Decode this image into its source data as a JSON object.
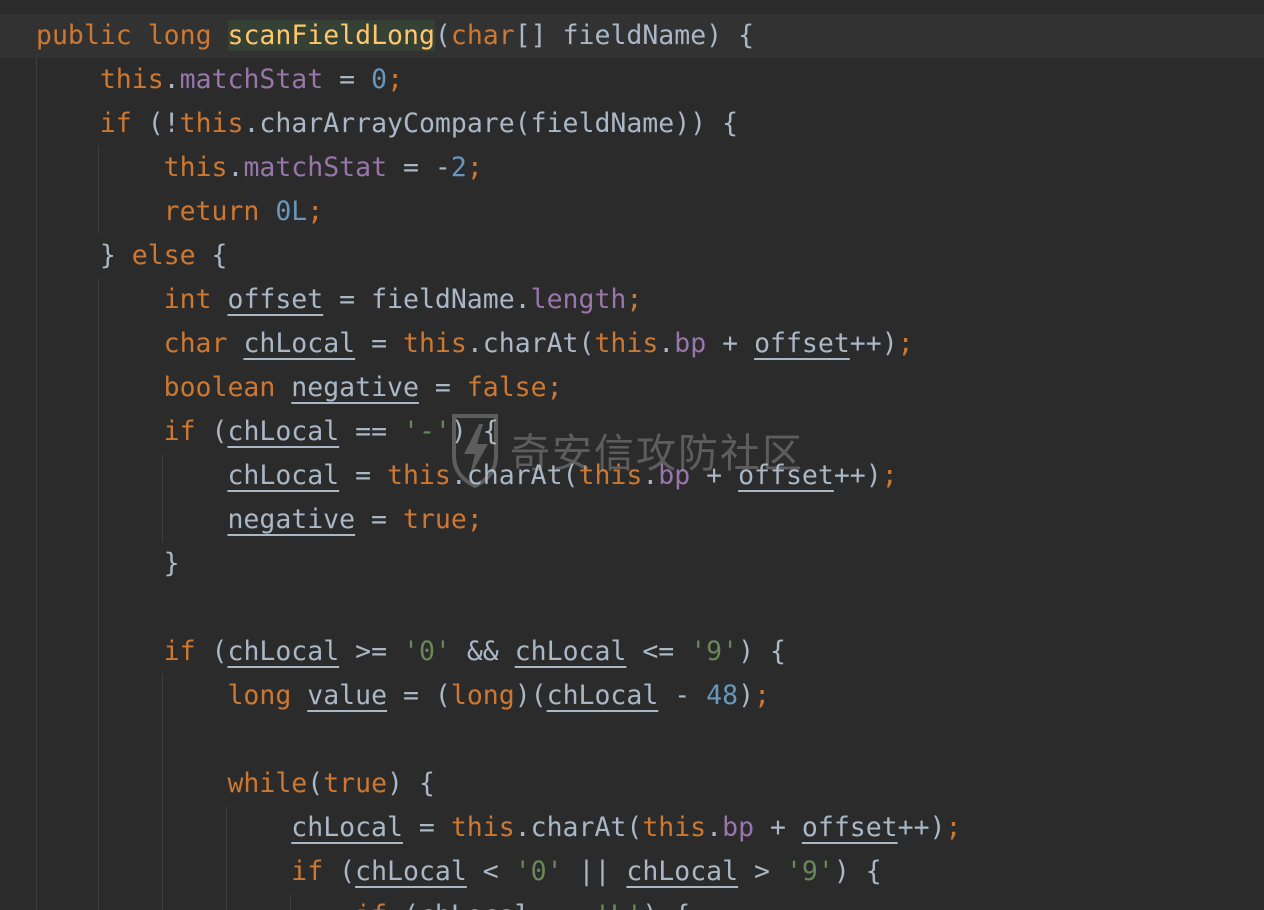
{
  "editor": {
    "watermark": "奇安信攻防社区",
    "lines": [
      {
        "tokens": [
          {
            "t": "public",
            "c": "kw"
          },
          {
            "t": " "
          },
          {
            "t": "long",
            "c": "kw"
          },
          {
            "t": " "
          },
          {
            "t": "scanFieldLong",
            "c": "fn hl"
          },
          {
            "t": "("
          },
          {
            "t": "char",
            "c": "kw"
          },
          {
            "t": "[] fieldName) {"
          }
        ]
      },
      {
        "tokens": [
          {
            "t": "    "
          },
          {
            "t": "this",
            "c": "kw"
          },
          {
            "t": "."
          },
          {
            "t": "matchStat",
            "c": "fld"
          },
          {
            "t": " = "
          },
          {
            "t": "0",
            "c": "num"
          },
          {
            "t": ";",
            "c": "kw"
          }
        ]
      },
      {
        "tokens": [
          {
            "t": "    "
          },
          {
            "t": "if",
            "c": "kw"
          },
          {
            "t": " (!"
          },
          {
            "t": "this",
            "c": "kw"
          },
          {
            "t": ".charArrayCompare(fieldName)) {"
          }
        ]
      },
      {
        "tokens": [
          {
            "t": "        "
          },
          {
            "t": "this",
            "c": "kw"
          },
          {
            "t": "."
          },
          {
            "t": "matchStat",
            "c": "fld"
          },
          {
            "t": " = -"
          },
          {
            "t": "2",
            "c": "num"
          },
          {
            "t": ";",
            "c": "kw"
          }
        ]
      },
      {
        "tokens": [
          {
            "t": "        "
          },
          {
            "t": "return",
            "c": "kw"
          },
          {
            "t": " "
          },
          {
            "t": "0L",
            "c": "num"
          },
          {
            "t": ";",
            "c": "kw"
          }
        ]
      },
      {
        "tokens": [
          {
            "t": "    } "
          },
          {
            "t": "else",
            "c": "kw"
          },
          {
            "t": " {"
          }
        ]
      },
      {
        "tokens": [
          {
            "t": "        "
          },
          {
            "t": "int",
            "c": "kw"
          },
          {
            "t": " "
          },
          {
            "t": "offset",
            "c": "var"
          },
          {
            "t": " = fieldName."
          },
          {
            "t": "length",
            "c": "fld"
          },
          {
            "t": ";",
            "c": "kw"
          }
        ]
      },
      {
        "tokens": [
          {
            "t": "        "
          },
          {
            "t": "char",
            "c": "kw"
          },
          {
            "t": " "
          },
          {
            "t": "chLocal",
            "c": "var"
          },
          {
            "t": " = "
          },
          {
            "t": "this",
            "c": "kw"
          },
          {
            "t": ".charAt("
          },
          {
            "t": "this",
            "c": "kw"
          },
          {
            "t": "."
          },
          {
            "t": "bp",
            "c": "fld"
          },
          {
            "t": " + "
          },
          {
            "t": "offset",
            "c": "var"
          },
          {
            "t": "++)"
          },
          {
            "t": ";",
            "c": "kw"
          }
        ]
      },
      {
        "tokens": [
          {
            "t": "        "
          },
          {
            "t": "boolean",
            "c": "kw"
          },
          {
            "t": " "
          },
          {
            "t": "negative",
            "c": "var"
          },
          {
            "t": " = "
          },
          {
            "t": "false",
            "c": "kw"
          },
          {
            "t": ";",
            "c": "kw"
          }
        ]
      },
      {
        "tokens": [
          {
            "t": "        "
          },
          {
            "t": "if",
            "c": "kw"
          },
          {
            "t": " ("
          },
          {
            "t": "chLocal",
            "c": "var"
          },
          {
            "t": " == "
          },
          {
            "t": "'-'",
            "c": "str"
          },
          {
            "t": ") {"
          }
        ]
      },
      {
        "tokens": [
          {
            "t": "            "
          },
          {
            "t": "chLocal",
            "c": "var"
          },
          {
            "t": " = "
          },
          {
            "t": "this",
            "c": "kw"
          },
          {
            "t": ".charAt("
          },
          {
            "t": "this",
            "c": "kw"
          },
          {
            "t": "."
          },
          {
            "t": "bp",
            "c": "fld"
          },
          {
            "t": " + "
          },
          {
            "t": "offset",
            "c": "var"
          },
          {
            "t": "++)"
          },
          {
            "t": ";",
            "c": "kw"
          }
        ]
      },
      {
        "tokens": [
          {
            "t": "            "
          },
          {
            "t": "negative",
            "c": "var"
          },
          {
            "t": " = "
          },
          {
            "t": "true",
            "c": "kw"
          },
          {
            "t": ";",
            "c": "kw"
          }
        ]
      },
      {
        "tokens": [
          {
            "t": "        }"
          }
        ]
      },
      {
        "tokens": [
          {
            "t": ""
          }
        ]
      },
      {
        "tokens": [
          {
            "t": "        "
          },
          {
            "t": "if",
            "c": "kw"
          },
          {
            "t": " ("
          },
          {
            "t": "chLocal",
            "c": "var"
          },
          {
            "t": " >= "
          },
          {
            "t": "'0'",
            "c": "str"
          },
          {
            "t": " && "
          },
          {
            "t": "chLocal",
            "c": "var"
          },
          {
            "t": " <= "
          },
          {
            "t": "'9'",
            "c": "str"
          },
          {
            "t": ") {"
          }
        ]
      },
      {
        "tokens": [
          {
            "t": "            "
          },
          {
            "t": "long",
            "c": "kw"
          },
          {
            "t": " "
          },
          {
            "t": "value",
            "c": "var"
          },
          {
            "t": " = ("
          },
          {
            "t": "long",
            "c": "kw"
          },
          {
            "t": ")("
          },
          {
            "t": "chLocal",
            "c": "var"
          },
          {
            "t": " - "
          },
          {
            "t": "48",
            "c": "num"
          },
          {
            "t": ")"
          },
          {
            "t": ";",
            "c": "kw"
          }
        ]
      },
      {
        "tokens": [
          {
            "t": ""
          }
        ]
      },
      {
        "tokens": [
          {
            "t": "            "
          },
          {
            "t": "while",
            "c": "kw"
          },
          {
            "t": "("
          },
          {
            "t": "true",
            "c": "kw"
          },
          {
            "t": ") {"
          }
        ]
      },
      {
        "tokens": [
          {
            "t": "                "
          },
          {
            "t": "chLocal",
            "c": "var"
          },
          {
            "t": " = "
          },
          {
            "t": "this",
            "c": "kw"
          },
          {
            "t": ".charAt("
          },
          {
            "t": "this",
            "c": "kw"
          },
          {
            "t": "."
          },
          {
            "t": "bp",
            "c": "fld"
          },
          {
            "t": " + "
          },
          {
            "t": "offset",
            "c": "var"
          },
          {
            "t": "++)"
          },
          {
            "t": ";",
            "c": "kw"
          }
        ]
      },
      {
        "tokens": [
          {
            "t": "                "
          },
          {
            "t": "if",
            "c": "kw"
          },
          {
            "t": " ("
          },
          {
            "t": "chLocal",
            "c": "var"
          },
          {
            "t": " < "
          },
          {
            "t": "'0'",
            "c": "str"
          },
          {
            "t": " || "
          },
          {
            "t": "chLocal",
            "c": "var"
          },
          {
            "t": " > "
          },
          {
            "t": "'9'",
            "c": "str"
          },
          {
            "t": ") {"
          }
        ]
      },
      {
        "tokens": [
          {
            "t": "                    "
          },
          {
            "t": "if",
            "c": "kw"
          },
          {
            "t": " ("
          },
          {
            "t": "chLocal",
            "c": "var"
          },
          {
            "t": " == "
          },
          {
            "t": "'L'",
            "c": "str"
          },
          {
            "t": ") {"
          }
        ]
      }
    ]
  }
}
